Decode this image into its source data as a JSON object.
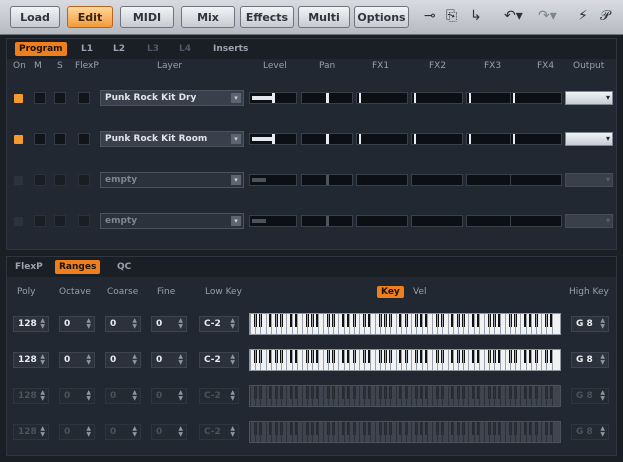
{
  "topbar": {
    "buttons": [
      "Load",
      "Edit",
      "MIDI",
      "Mix",
      "Effects",
      "Multi",
      "Options"
    ],
    "active": "Edit",
    "tools": [
      "connect-icon",
      "import-icon",
      "route-icon",
      "undo-icon",
      "redo-icon",
      "wand-icon",
      "pin-icon"
    ]
  },
  "layers_panel": {
    "tabs": [
      "Program",
      "L1",
      "L2",
      "L3",
      "L4",
      "Inserts"
    ],
    "active_tab": "Program",
    "headers": {
      "on": "On",
      "m": "M",
      "s": "S",
      "flexp": "FlexP",
      "layer": "Layer",
      "level": "Level",
      "pan": "Pan",
      "fx1": "FX1",
      "fx2": "FX2",
      "fx3": "FX3",
      "fx4": "FX4",
      "output": "Output"
    },
    "rows": [
      {
        "on": true,
        "name": "Punk Rock Kit Dry",
        "level": 0.55,
        "pan": 0.5,
        "enabled": true
      },
      {
        "on": true,
        "name": "Punk Rock Kit Room",
        "level": 0.55,
        "pan": 0.5,
        "enabled": true
      },
      {
        "on": false,
        "name": "empty",
        "level": 0.35,
        "pan": 0.5,
        "enabled": false
      },
      {
        "on": false,
        "name": "empty",
        "level": 0.35,
        "pan": 0.5,
        "enabled": false
      }
    ]
  },
  "ranges_panel": {
    "tabs": [
      "FlexP",
      "Ranges",
      "QC"
    ],
    "active_tab": "Ranges",
    "headers": {
      "poly": "Poly",
      "octave": "Octave",
      "coarse": "Coarse",
      "fine": "Fine",
      "lowkey": "Low Key",
      "key": "Key",
      "vel": "Vel",
      "highkey": "High Key"
    },
    "rows": [
      {
        "poly": "128",
        "octave": "0",
        "coarse": "0",
        "fine": "0",
        "low": "C-2",
        "high": "G 8",
        "enabled": true
      },
      {
        "poly": "128",
        "octave": "0",
        "coarse": "0",
        "fine": "0",
        "low": "C-2",
        "high": "G 8",
        "enabled": true
      },
      {
        "poly": "128",
        "octave": "0",
        "coarse": "0",
        "fine": "0",
        "low": "C-2",
        "high": "G 8",
        "enabled": false
      },
      {
        "poly": "128",
        "octave": "0",
        "coarse": "0",
        "fine": "0",
        "low": "C-2",
        "high": "G 8",
        "enabled": false
      }
    ]
  },
  "colors": {
    "accent": "#ef7f1d",
    "panel": "#222831",
    "bg": "#1a1e25"
  }
}
